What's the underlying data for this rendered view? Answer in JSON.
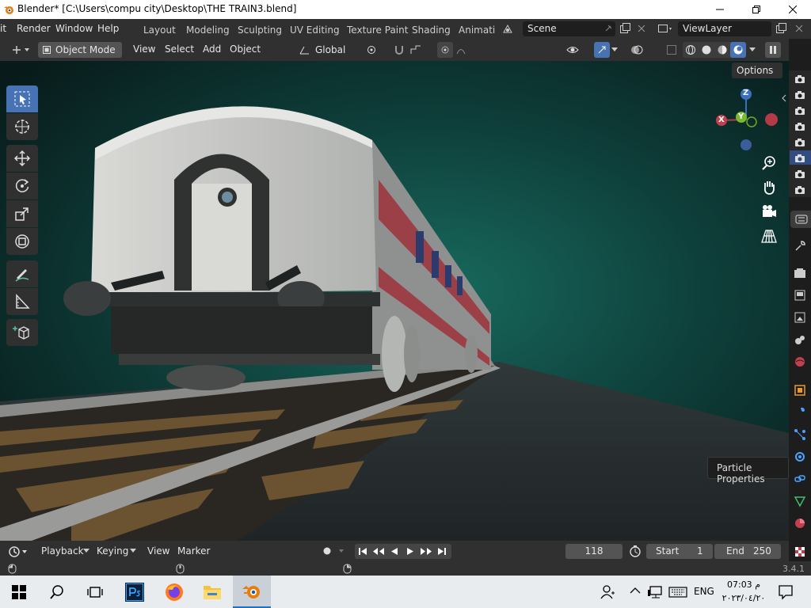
{
  "window": {
    "title": "Blender* [C:\\Users\\compu city\\Desktop\\THE TRAIN3.blend]",
    "minimize_icon": "minimize-icon",
    "maximize_icon": "restore-icon",
    "close_icon": "close-icon"
  },
  "menubar": {
    "items": [
      "it",
      "Render",
      "Window",
      "Help"
    ]
  },
  "workspaces": [
    "Layout",
    "Modeling",
    "Sculpting",
    "UV Editing",
    "Texture Paint",
    "Shading",
    "Animati"
  ],
  "scene": {
    "label": "Scene"
  },
  "viewlayer": {
    "label": "ViewLayer"
  },
  "header": {
    "mode": "Object Mode",
    "menus": [
      "View",
      "Select",
      "Add",
      "Object"
    ],
    "orientation": "Global"
  },
  "viewport": {
    "options_label": "Options",
    "gizmo": {
      "z": "Z",
      "y": "Y",
      "x": "X"
    },
    "tooltip": "Particle Properties"
  },
  "toolbar": {
    "tools": [
      "select-box-icon",
      "cursor-icon",
      "move-icon",
      "rotate-icon",
      "scale-icon",
      "transform-icon",
      "annotate-icon",
      "measure-icon",
      "add-cube-icon"
    ]
  },
  "timeline": {
    "menus": [
      "Playback",
      "Keying",
      "View",
      "Marker"
    ],
    "current_frame": "118",
    "start_label": "Start",
    "start_value": "1",
    "end_label": "End",
    "end_value": "250"
  },
  "statusbar": {
    "version": "3.4.1"
  },
  "taskbar": {
    "lang": "ENG",
    "time": "07:03 م",
    "date": "٢٠٢٣/٠٤/٢٠"
  },
  "colors": {
    "accent": "#4772b3",
    "bg": "#303030",
    "header": "#303030",
    "field": "#545454",
    "viewport_bg": "#0d1f1e"
  }
}
